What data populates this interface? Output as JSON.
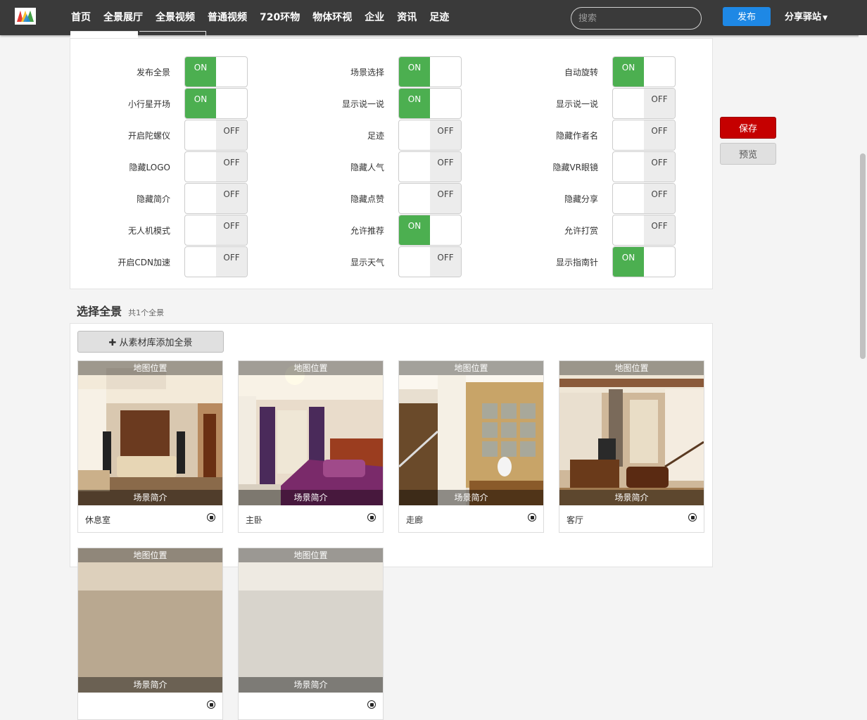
{
  "nav": {
    "items": [
      "首页",
      "全景展厅",
      "全景视频",
      "普通视频",
      "720环物",
      "物体环视",
      "企业",
      "资讯",
      "足迹"
    ],
    "search_placeholder": "搜索",
    "publish_label": "发布",
    "share_label": "分享驿站"
  },
  "settings": {
    "columns": [
      [
        {
          "label": "发布全景",
          "on": true
        },
        {
          "label": "小行星开场",
          "on": true
        },
        {
          "label": "开启陀螺仪",
          "on": false
        },
        {
          "label": "隐藏LOGO",
          "on": false
        },
        {
          "label": "隐藏简介",
          "on": false
        },
        {
          "label": "无人机模式",
          "on": false
        },
        {
          "label": "开启CDN加速",
          "on": false
        }
      ],
      [
        {
          "label": "场景选择",
          "on": true
        },
        {
          "label": "显示说一说",
          "on": true
        },
        {
          "label": "足迹",
          "on": false
        },
        {
          "label": "隐藏人气",
          "on": false
        },
        {
          "label": "隐藏点赞",
          "on": false
        },
        {
          "label": "允许推荐",
          "on": true
        },
        {
          "label": "显示天气",
          "on": false
        }
      ],
      [
        {
          "label": "自动旋转",
          "on": true
        },
        {
          "label": "显示说一说",
          "on": false
        },
        {
          "label": "隐藏作者名",
          "on": false
        },
        {
          "label": "隐藏VR眼镜",
          "on": false
        },
        {
          "label": "隐藏分享",
          "on": false
        },
        {
          "label": "允许打赏",
          "on": false
        },
        {
          "label": "显示指南针",
          "on": true
        }
      ]
    ],
    "on_text": "ON",
    "off_text": "OFF"
  },
  "actions": {
    "save_label": "保存",
    "preview_label": "预览"
  },
  "panorama": {
    "title": "选择全景",
    "count_text": "共1个全景",
    "add_label": "从素材库添加全景",
    "map_label": "地图位置",
    "desc_label": "场景简介",
    "cards": [
      {
        "name": "休息室"
      },
      {
        "name": "主卧"
      },
      {
        "name": "走廊"
      },
      {
        "name": "客厅"
      },
      {
        "name": ""
      },
      {
        "name": ""
      }
    ]
  }
}
